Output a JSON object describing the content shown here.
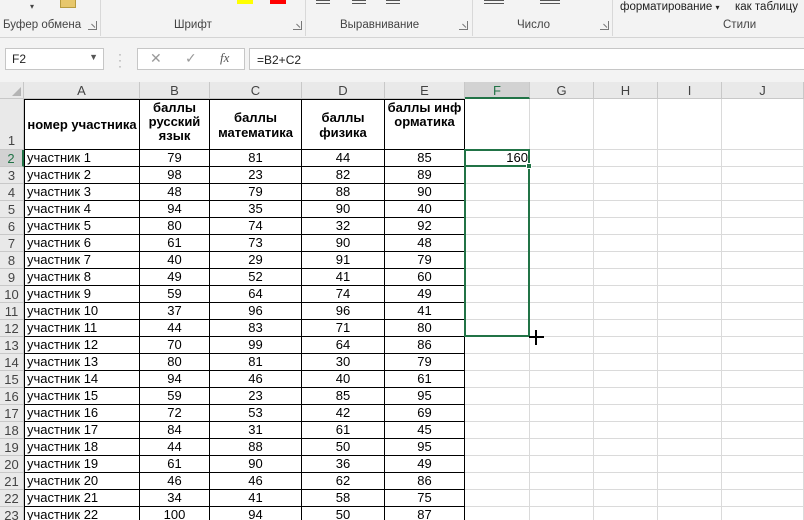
{
  "ribbon": {
    "clipboard_label": "Буфер обмена",
    "font_label": "Шрифт",
    "alignment_label": "Выравнивание",
    "number_label": "Число",
    "styles_label": "Стили",
    "format_as_button": "форматирование",
    "as_table_button": "как таблицу",
    "font_color_accent": "#ffff00",
    "font_color_red": "#ff0000"
  },
  "formula_bar": {
    "name_box": "F2",
    "cancel_icon": "✕",
    "enter_icon": "✓",
    "fx_icon": "fx",
    "formula": "=B2+C2"
  },
  "grid": {
    "columns": [
      "A",
      "B",
      "C",
      "D",
      "E",
      "F",
      "G",
      "H",
      "I",
      "J"
    ],
    "selected_column": "F",
    "row_numbers": [
      "1",
      "2",
      "3",
      "4",
      "5",
      "6",
      "7",
      "8",
      "9",
      "10",
      "11",
      "12",
      "13",
      "14",
      "15",
      "16",
      "17",
      "18",
      "19",
      "20",
      "21",
      "22",
      "23"
    ],
    "header": {
      "a": "номер участника",
      "b": "баллы русский язык",
      "c": "баллы математика",
      "d": "баллы физика",
      "e": "баллы информатика"
    },
    "rows": [
      [
        "участник 1",
        "79",
        "81",
        "44",
        "85"
      ],
      [
        "участник 2",
        "98",
        "23",
        "82",
        "89"
      ],
      [
        "участник 3",
        "48",
        "79",
        "88",
        "90"
      ],
      [
        "участник 4",
        "94",
        "35",
        "90",
        "40"
      ],
      [
        "участник 5",
        "80",
        "74",
        "32",
        "92"
      ],
      [
        "участник 6",
        "61",
        "73",
        "90",
        "48"
      ],
      [
        "участник 7",
        "40",
        "29",
        "91",
        "79"
      ],
      [
        "участник 8",
        "49",
        "52",
        "41",
        "60"
      ],
      [
        "участник 9",
        "59",
        "64",
        "74",
        "49"
      ],
      [
        "участник 10",
        "37",
        "96",
        "96",
        "41"
      ],
      [
        "участник 11",
        "44",
        "83",
        "71",
        "80"
      ],
      [
        "участник 12",
        "70",
        "99",
        "64",
        "86"
      ],
      [
        "участник 13",
        "80",
        "81",
        "30",
        "79"
      ],
      [
        "участник 14",
        "94",
        "46",
        "40",
        "61"
      ],
      [
        "участник 15",
        "59",
        "23",
        "85",
        "95"
      ],
      [
        "участник 16",
        "72",
        "53",
        "42",
        "69"
      ],
      [
        "участник 17",
        "84",
        "31",
        "61",
        "45"
      ],
      [
        "участник 18",
        "44",
        "88",
        "50",
        "95"
      ],
      [
        "участник 19",
        "61",
        "90",
        "36",
        "49"
      ],
      [
        "участник 20",
        "46",
        "46",
        "62",
        "86"
      ],
      [
        "участник 21",
        "34",
        "41",
        "58",
        "75"
      ],
      [
        "участник 22",
        "100",
        "94",
        "50",
        "87"
      ]
    ],
    "f2_value": "160"
  }
}
